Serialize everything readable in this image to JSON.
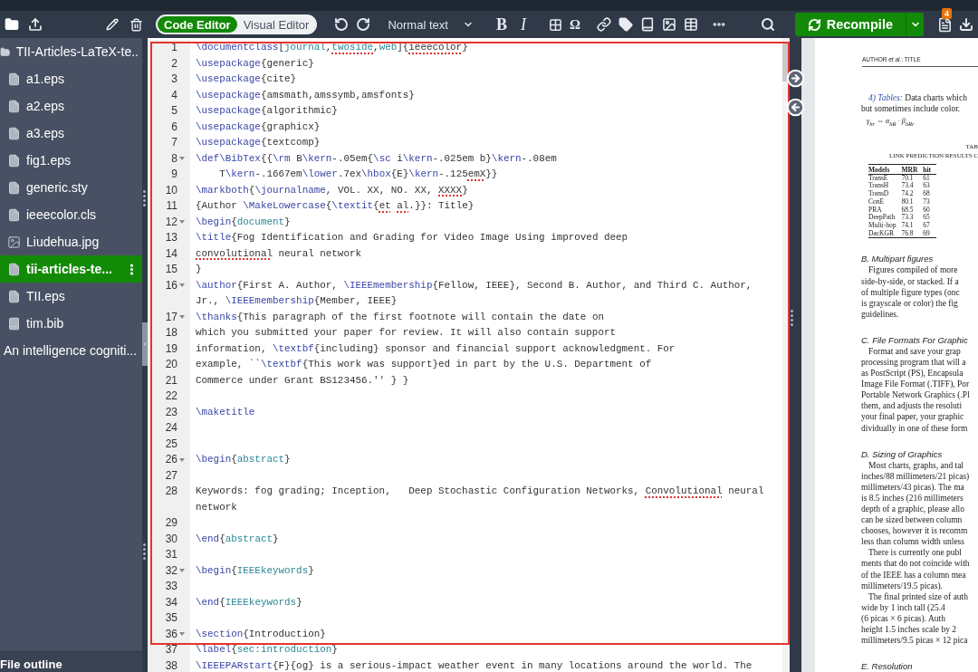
{
  "toolbar": {
    "mode_toggle": [
      {
        "label": "Code Editor",
        "selected": true
      },
      {
        "label": "Visual Editor",
        "selected": false
      }
    ],
    "text_style": "Normal text",
    "format_buttons": [
      {
        "label": "B",
        "kind": "bold"
      },
      {
        "label": "I",
        "kind": "italic"
      }
    ],
    "symbol_button": "Ω",
    "recompile": "Recompile",
    "notification_count": "4"
  },
  "file_tree": [
    {
      "name": "TII-Articles-LaTeX-te..",
      "kind": "folder",
      "selected": false,
      "children": [
        {
          "name": "a1.eps",
          "kind": "file",
          "selected": false
        },
        {
          "name": "a2.eps",
          "kind": "file",
          "selected": false
        },
        {
          "name": "a3.eps",
          "kind": "file",
          "selected": false
        },
        {
          "name": "fig1.eps",
          "kind": "file",
          "selected": false
        },
        {
          "name": "generic.sty",
          "kind": "file",
          "selected": false
        },
        {
          "name": "ieeecolor.cls",
          "kind": "file",
          "selected": false
        },
        {
          "name": "Liudehua.jpg",
          "kind": "image",
          "selected": false
        },
        {
          "name": "tii-articles-te...",
          "kind": "file",
          "selected": true
        },
        {
          "name": "TII.eps",
          "kind": "file",
          "selected": false
        },
        {
          "name": "tim.bib",
          "kind": "bib",
          "selected": false
        }
      ]
    },
    {
      "name": "An intelligence cogniti...",
      "kind": "plain",
      "selected": false
    }
  ],
  "file_outline": "File outline",
  "editor": {
    "highlighted": true,
    "lines": [
      {
        "number": "1",
        "fold": false,
        "rows": [
          [
            {
              "kind": "cmd",
              "text": "\\documentclass"
            },
            {
              "kind": "text",
              "text": "["
            },
            {
              "kind": "arg",
              "text": "journal"
            },
            {
              "kind": "text",
              "text": ","
            },
            {
              "kind": "arg",
              "text": "twoside",
              "misspelled": true
            },
            {
              "kind": "text",
              "text": ","
            },
            {
              "kind": "arg",
              "text": "web"
            },
            {
              "kind": "text",
              "text": "]{"
            },
            {
              "kind": "text",
              "text": "ieeecolor",
              "misspelled": true
            },
            {
              "kind": "text",
              "text": "}"
            }
          ]
        ]
      },
      {
        "number": "2",
        "fold": false,
        "rows": [
          [
            {
              "kind": "cmd",
              "text": "\\usepackage"
            },
            {
              "kind": "text",
              "text": "{generic}"
            }
          ]
        ]
      },
      {
        "number": "3",
        "fold": false,
        "rows": [
          [
            {
              "kind": "cmd",
              "text": "\\usepackage"
            },
            {
              "kind": "text",
              "text": "{cite}"
            }
          ]
        ]
      },
      {
        "number": "4",
        "fold": false,
        "rows": [
          [
            {
              "kind": "cmd",
              "text": "\\usepackage"
            },
            {
              "kind": "text",
              "text": "{amsmath,amssymb,amsfonts}"
            }
          ]
        ]
      },
      {
        "number": "5",
        "fold": false,
        "rows": [
          [
            {
              "kind": "cmd",
              "text": "\\usepackage"
            },
            {
              "kind": "text",
              "text": "{algorithmic}"
            }
          ]
        ]
      },
      {
        "number": "6",
        "fold": false,
        "rows": [
          [
            {
              "kind": "cmd",
              "text": "\\usepackage"
            },
            {
              "kind": "text",
              "text": "{graphicx}"
            }
          ]
        ]
      },
      {
        "number": "7",
        "fold": false,
        "rows": [
          [
            {
              "kind": "cmd",
              "text": "\\usepackage"
            },
            {
              "kind": "text",
              "text": "{textcomp}"
            }
          ]
        ]
      },
      {
        "number": "8",
        "fold": true,
        "rows": [
          [
            {
              "kind": "cmd",
              "text": "\\def"
            },
            {
              "kind": "cmd",
              "text": "\\BibTex"
            },
            {
              "kind": "text",
              "text": "{{"
            },
            {
              "kind": "cmd",
              "text": "\\rm"
            },
            {
              "kind": "text",
              "text": " B"
            },
            {
              "kind": "cmd",
              "text": "\\kern"
            },
            {
              "kind": "text",
              "text": "-.05em{"
            },
            {
              "kind": "cmd",
              "text": "\\sc"
            },
            {
              "kind": "text",
              "text": " i"
            },
            {
              "kind": "cmd",
              "text": "\\kern"
            },
            {
              "kind": "text",
              "text": "-.025em b}"
            },
            {
              "kind": "cmd",
              "text": "\\kern"
            },
            {
              "kind": "text",
              "text": "-.08em"
            }
          ]
        ]
      },
      {
        "number": "9",
        "fold": false,
        "rows": [
          [
            {
              "kind": "text",
              "text": "    T"
            },
            {
              "kind": "cmd",
              "text": "\\kern"
            },
            {
              "kind": "text",
              "text": "-.1667em"
            },
            {
              "kind": "cmd",
              "text": "\\lower"
            },
            {
              "kind": "text",
              "text": ".7ex"
            },
            {
              "kind": "cmd",
              "text": "\\hbox"
            },
            {
              "kind": "text",
              "text": "{E}"
            },
            {
              "kind": "cmd",
              "text": "\\kern"
            },
            {
              "kind": "text",
              "text": "-.125"
            },
            {
              "kind": "text",
              "text": "emX",
              "misspelled": true
            },
            {
              "kind": "text",
              "text": "}}"
            }
          ]
        ]
      },
      {
        "number": "10",
        "fold": false,
        "rows": [
          [
            {
              "kind": "cmd",
              "text": "\\markboth"
            },
            {
              "kind": "text",
              "text": "{"
            },
            {
              "kind": "cmd",
              "text": "\\journalname"
            },
            {
              "kind": "text",
              "text": ", VOL. XX, NO. XX, "
            },
            {
              "kind": "text",
              "text": "XXXX",
              "misspelled": true
            },
            {
              "kind": "text",
              "text": "}"
            }
          ]
        ]
      },
      {
        "number": "11",
        "fold": false,
        "rows": [
          [
            {
              "kind": "text",
              "text": "{Author "
            },
            {
              "kind": "cmd",
              "text": "\\MakeLowercase"
            },
            {
              "kind": "text",
              "text": "{"
            },
            {
              "kind": "cmd",
              "text": "\\textit"
            },
            {
              "kind": "text",
              "text": "{"
            },
            {
              "kind": "text",
              "text": "et",
              "misspelled": true
            },
            {
              "kind": "text",
              "text": " "
            },
            {
              "kind": "text",
              "text": "al",
              "misspelled": true
            },
            {
              "kind": "text",
              "text": ".}}: Title}"
            }
          ]
        ]
      },
      {
        "number": "12",
        "fold": true,
        "rows": [
          [
            {
              "kind": "cmd",
              "text": "\\begin"
            },
            {
              "kind": "text",
              "text": "{"
            },
            {
              "kind": "arg",
              "text": "document"
            },
            {
              "kind": "text",
              "text": "}"
            }
          ]
        ]
      },
      {
        "number": "13",
        "fold": false,
        "rows": [
          [
            {
              "kind": "cmd",
              "text": "\\title"
            },
            {
              "kind": "text",
              "text": "{Fog Identification and Grading for Video Image Using improved deep"
            }
          ]
        ]
      },
      {
        "number": "14",
        "fold": false,
        "rows": [
          [
            {
              "kind": "text",
              "text": "convolutional",
              "misspelled": true
            },
            {
              "kind": "text",
              "text": " neural network"
            }
          ]
        ]
      },
      {
        "number": "15",
        "fold": false,
        "rows": [
          [
            {
              "kind": "text",
              "text": "}"
            }
          ]
        ]
      },
      {
        "number": "16",
        "fold": true,
        "rows": [
          [
            {
              "kind": "cmd",
              "text": "\\author"
            },
            {
              "kind": "text",
              "text": "{First A. Author, "
            },
            {
              "kind": "cmd",
              "text": "\\IEEEmembership"
            },
            {
              "kind": "text",
              "text": "{Fellow, IEEE}, Second B. Author, and Third C. Author,"
            }
          ],
          [
            {
              "kind": "text",
              "text": "Jr., "
            },
            {
              "kind": "cmd",
              "text": "\\IEEEmembership"
            },
            {
              "kind": "text",
              "text": "{Member, IEEE}"
            }
          ]
        ]
      },
      {
        "number": "17",
        "fold": true,
        "rows": [
          [
            {
              "kind": "cmd",
              "text": "\\thanks"
            },
            {
              "kind": "text",
              "text": "{This paragraph of the first footnote will contain the date on"
            }
          ]
        ]
      },
      {
        "number": "18",
        "fold": false,
        "rows": [
          [
            {
              "kind": "text",
              "text": "which you submitted your paper for review. It will also contain support"
            }
          ]
        ]
      },
      {
        "number": "19",
        "fold": false,
        "rows": [
          [
            {
              "kind": "text",
              "text": "information, "
            },
            {
              "kind": "cmd",
              "text": "\\textbf"
            },
            {
              "kind": "text",
              "text": "{including} sponsor and financial support acknowledgment. For"
            }
          ]
        ]
      },
      {
        "number": "20",
        "fold": false,
        "rows": [
          [
            {
              "kind": "text",
              "text": "example, ``"
            },
            {
              "kind": "cmd",
              "text": "\\textbf"
            },
            {
              "kind": "text",
              "text": "{This work was support}ed in part by the U.S. Department of"
            }
          ]
        ]
      },
      {
        "number": "21",
        "fold": false,
        "rows": [
          [
            {
              "kind": "text",
              "text": "Commerce under Grant BS123456.'' } }"
            }
          ]
        ]
      },
      {
        "number": "22",
        "fold": false,
        "rows": [
          []
        ]
      },
      {
        "number": "23",
        "fold": false,
        "rows": [
          [
            {
              "kind": "cmd",
              "text": "\\maketitle"
            }
          ]
        ]
      },
      {
        "number": "24",
        "fold": false,
        "rows": [
          []
        ]
      },
      {
        "number": "25",
        "fold": false,
        "rows": [
          []
        ]
      },
      {
        "number": "26",
        "fold": true,
        "rows": [
          [
            {
              "kind": "cmd",
              "text": "\\begin"
            },
            {
              "kind": "text",
              "text": "{"
            },
            {
              "kind": "arg",
              "text": "abstract"
            },
            {
              "kind": "text",
              "text": "}"
            }
          ]
        ]
      },
      {
        "number": "27",
        "fold": false,
        "rows": [
          []
        ]
      },
      {
        "number": "28",
        "fold": false,
        "rows": [
          [
            {
              "kind": "text",
              "text": "Keywords: fog grading; Inception,   Deep Stochastic Configuration Networks, "
            },
            {
              "kind": "text",
              "text": "Convolutional",
              "misspelled": true
            },
            {
              "kind": "text",
              "text": " neural"
            }
          ],
          [
            {
              "kind": "text",
              "text": "network"
            }
          ]
        ]
      },
      {
        "number": "29",
        "fold": false,
        "rows": [
          []
        ]
      },
      {
        "number": "30",
        "fold": false,
        "rows": [
          [
            {
              "kind": "cmd",
              "text": "\\end"
            },
            {
              "kind": "text",
              "text": "{"
            },
            {
              "kind": "arg",
              "text": "abstract"
            },
            {
              "kind": "text",
              "text": "}"
            }
          ]
        ]
      },
      {
        "number": "31",
        "fold": false,
        "rows": [
          []
        ]
      },
      {
        "number": "32",
        "fold": true,
        "rows": [
          [
            {
              "kind": "cmd",
              "text": "\\begin"
            },
            {
              "kind": "text",
              "text": "{"
            },
            {
              "kind": "arg",
              "text": "IEEEkeywords"
            },
            {
              "kind": "text",
              "text": "}"
            }
          ]
        ]
      },
      {
        "number": "33",
        "fold": false,
        "rows": [
          []
        ]
      },
      {
        "number": "34",
        "fold": false,
        "rows": [
          [
            {
              "kind": "cmd",
              "text": "\\end"
            },
            {
              "kind": "text",
              "text": "{"
            },
            {
              "kind": "arg",
              "text": "IEEEkeywords"
            },
            {
              "kind": "text",
              "text": "}"
            }
          ]
        ]
      },
      {
        "number": "35",
        "fold": false,
        "rows": [
          []
        ]
      },
      {
        "number": "36",
        "fold": true,
        "rows": [
          [
            {
              "kind": "cmd",
              "text": "\\section"
            },
            {
              "kind": "text",
              "text": "{Introduction}"
            }
          ]
        ]
      },
      {
        "number": "37",
        "fold": false,
        "rows": [
          [
            {
              "kind": "cmd",
              "text": "\\label"
            },
            {
              "kind": "text",
              "text": "{"
            },
            {
              "kind": "arg",
              "text": "sec:introduction"
            },
            {
              "kind": "text",
              "text": "}"
            }
          ]
        ]
      },
      {
        "number": "38",
        "fold": false,
        "rows": [
          [
            {
              "kind": "cmd",
              "text": "\\IEEEPARstart"
            },
            {
              "kind": "text",
              "text": "{F}{og} is a serious-impact weather event in many locations around the world. The"
            }
          ]
        ]
      }
    ]
  },
  "pdf": {
    "header": "AUTHOR *et al.*: TITLE",
    "blocks": [
      {
        "kind": "paragraph",
        "lead": "4) Tables:",
        "lines": [
          "Data charts which",
          "but sometimes include color."
        ]
      },
      {
        "kind": "formula",
        "text": "γ$_{hr}$ ⇔ α$_{hR}$ · β$_{hRr}$"
      },
      {
        "kind": "caption",
        "lines": [
          "TAB",
          "LINK PREDICTION RESULTS C"
        ]
      },
      {
        "kind": "table",
        "columns": [
          "Models",
          "MRR",
          "hit"
        ],
        "rows": [
          [
            "TransE",
            "70.1",
            "61"
          ],
          [
            "TransH",
            "73.4",
            "63"
          ],
          [
            "TransD",
            "74.2",
            "68"
          ],
          [
            "ConE",
            "80.1",
            "73"
          ],
          [
            "PRA",
            "68.5",
            "60"
          ],
          [
            "DeepPath",
            "73.3",
            "65"
          ],
          [
            "Multi-hop",
            "74.1",
            "67"
          ],
          [
            "DacKGR",
            "76.8",
            "69"
          ]
        ]
      },
      {
        "kind": "heading",
        "text": "B. Multipart figures"
      },
      {
        "kind": "paragraph",
        "lines": [
          "Figures compiled of more",
          "side-by-side, or stacked. If a",
          "of multiple figure types (onc",
          "is grayscale or color) the fig",
          "guidelines."
        ]
      },
      {
        "kind": "heading",
        "text": "C. File Formats For Graphic"
      },
      {
        "kind": "paragraph",
        "lines": [
          "Format and save your grap",
          "processing program that will a",
          "as PostScript (PS), Encapsula",
          "Image File Format (.TIFF), Por",
          "Portable Network Graphics (.Pl",
          "them, and adjusts the resoluti",
          "your final paper, your graphic",
          "dividually in one of these form"
        ]
      },
      {
        "kind": "heading",
        "text": "D. Sizing of Graphics"
      },
      {
        "kind": "paragraph",
        "lines": [
          "Most charts, graphs, and tal",
          "inches/88 millimeters/21 picas)",
          "millimeters/43 picas). The ma",
          "is 8.5 inches (216 millimeters",
          "depth of a graphic, please allo",
          "can be sized between column",
          "chooses, however it is recomm",
          "less than column width unless"
        ]
      },
      {
        "kind": "paragraph",
        "lines": [
          "There is currently one publ",
          "ments that do not coincide with",
          "of the IEEE has a column mea",
          "millimeters/19.5 picas)."
        ]
      },
      {
        "kind": "paragraph",
        "lines": [
          "The final printed size of auth",
          "wide by 1 inch tall (25.4",
          "(6 picas × 6 picas). Auth",
          "height 1.5 inches scale by 2",
          "millimeters/9.5 picas × 12 pica"
        ]
      },
      {
        "kind": "heading",
        "text": "E. Resolution"
      }
    ]
  }
}
